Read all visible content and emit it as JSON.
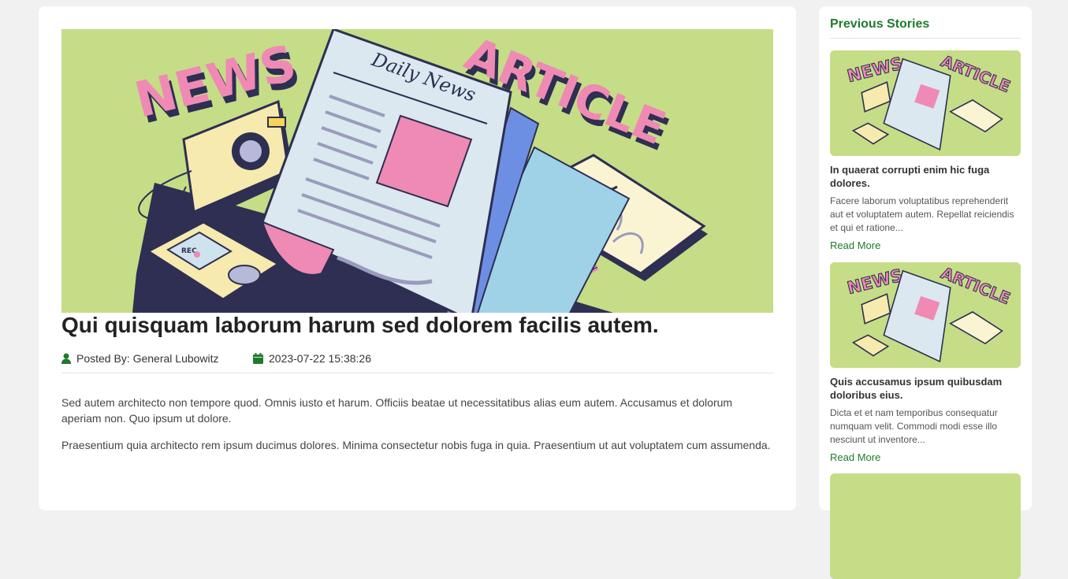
{
  "article": {
    "hero_image": "news-article-illustration",
    "title": "Qui quisquam laborum harum sed dolorem facilis autem.",
    "meta": {
      "author_label": "Posted By: General Lubowitz",
      "author_icon": "user-icon",
      "date": "2023-07-22 15:38:26",
      "date_icon": "calendar-icon"
    },
    "paragraphs": [
      "Sed autem architecto non tempore quod. Omnis iusto et harum. Officiis beatae ut necessitatibus alias eum autem. Accusamus et dolorum aperiam non. Quo ipsum ut dolore.",
      "Praesentium quia architecto rem ipsum ducimus dolores. Minima consectetur nobis fuga in quia. Praesentium ut aut voluptatem cum assumenda."
    ],
    "illustration_text": {
      "word1": "NEWS",
      "word2": "ARTICLE",
      "paper_title": "Daily News",
      "recorder_label": "REC"
    }
  },
  "sidebar": {
    "heading": "Previous Stories",
    "stories": [
      {
        "title": "In quaerat corrupti enim hic fuga dolores.",
        "excerpt": "Facere laborum voluptatibus reprehenderit aut et voluptatem autem. Repellat reiciendis et qui et ratione...",
        "read_more": "Read More"
      },
      {
        "title": "Quis accusamus ipsum quibusdam doloribus eius.",
        "excerpt": "Dicta et et nam temporibus consequatur numquam velit. Commodi modi esse illo nesciunt ut inventore...",
        "read_more": "Read More"
      }
    ]
  },
  "colors": {
    "accent_green": "#1e7b2c",
    "hero_bg": "#c5dd86",
    "pink": "#ef8ab4",
    "navy": "#2e2f52"
  }
}
